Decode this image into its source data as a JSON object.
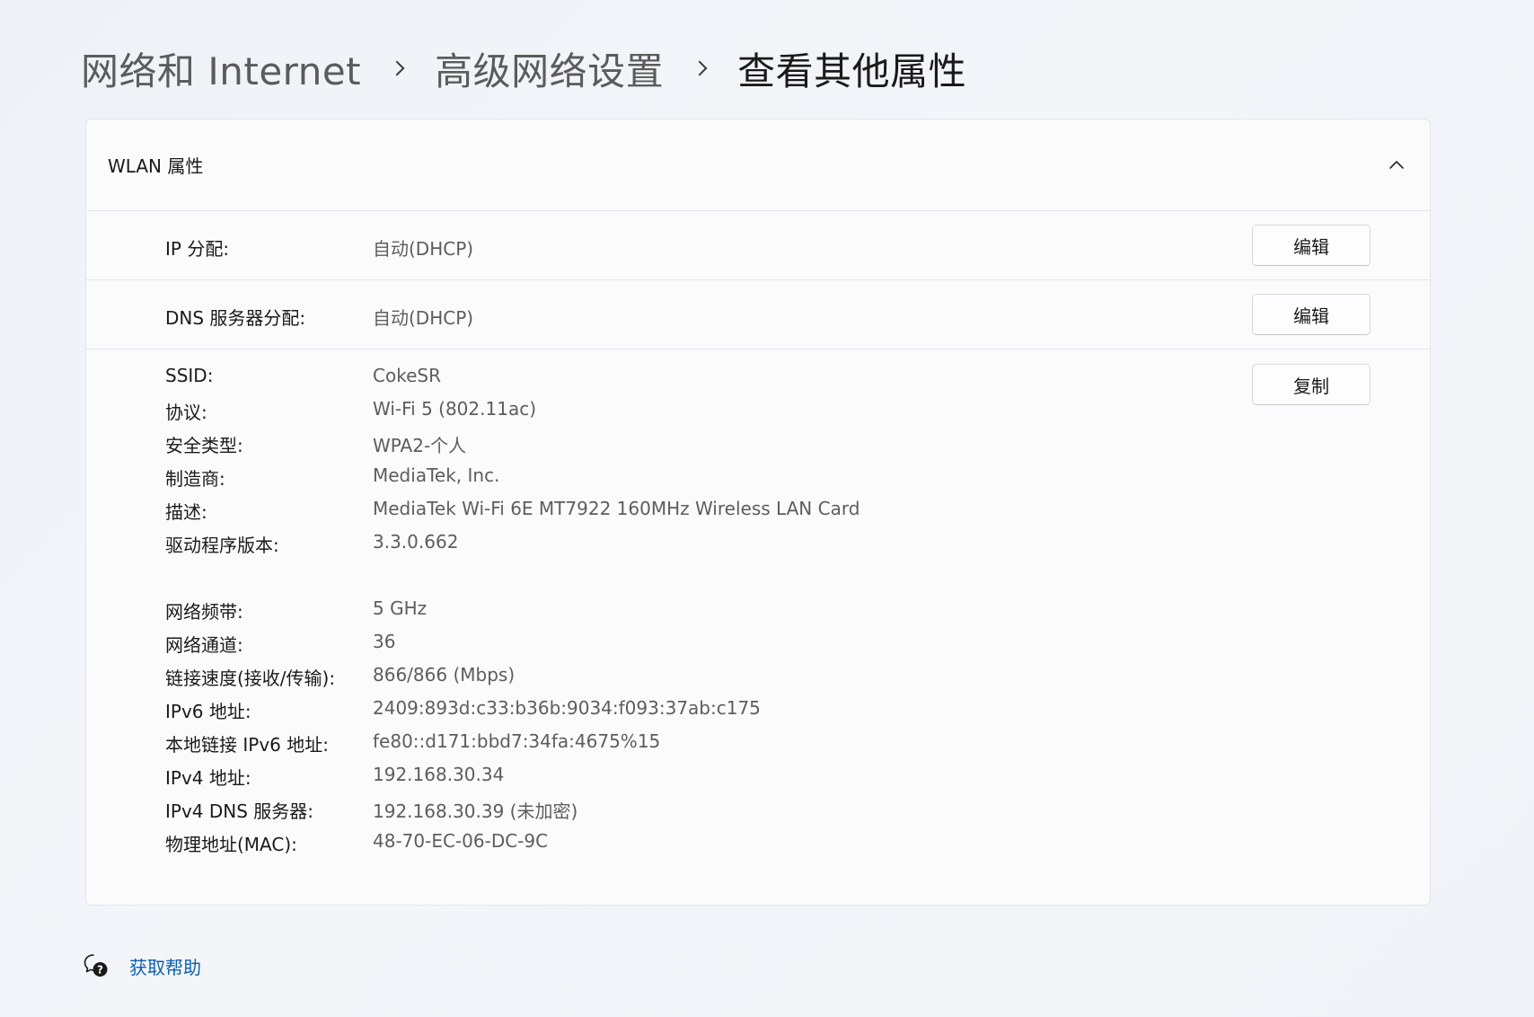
{
  "breadcrumb": {
    "items": [
      "网络和 Internet",
      "高级网络设置"
    ],
    "current": "查看其他属性"
  },
  "card": {
    "title": "WLAN 属性",
    "collapse_icon": "chevron-up-icon",
    "ip_assignment": {
      "label": "IP 分配:",
      "value": "自动(DHCP)",
      "button": "编辑"
    },
    "dns_assignment": {
      "label": "DNS 服务器分配:",
      "value": "自动(DHCP)",
      "button": "编辑"
    },
    "details": {
      "copy_button": "复制",
      "group1": [
        {
          "label": "SSID:",
          "value": "CokeSR"
        },
        {
          "label": "协议:",
          "value": "Wi-Fi 5 (802.11ac)"
        },
        {
          "label": "安全类型:",
          "value": "WPA2-个人"
        },
        {
          "label": "制造商:",
          "value": "MediaTek, Inc."
        },
        {
          "label": "描述:",
          "value": "MediaTek Wi-Fi 6E MT7922 160MHz Wireless LAN Card"
        },
        {
          "label": "驱动程序版本:",
          "value": "3.3.0.662"
        }
      ],
      "group2": [
        {
          "label": "网络频带:",
          "value": "5 GHz"
        },
        {
          "label": "网络通道:",
          "value": "36"
        },
        {
          "label": "链接速度(接收/传输):",
          "value": "866/866 (Mbps)"
        },
        {
          "label": "IPv6 地址:",
          "value": "2409:893d:c33:b36b:9034:f093:37ab:c175"
        },
        {
          "label": "本地链接 IPv6 地址:",
          "value": "fe80::d171:bbd7:34fa:4675%15"
        },
        {
          "label": "IPv4 地址:",
          "value": "192.168.30.34"
        },
        {
          "label": "IPv4 DNS 服务器:",
          "value": "192.168.30.39 (未加密)"
        },
        {
          "label": "物理地址(MAC):",
          "value": "48-70-EC-06-DC-9C"
        }
      ]
    }
  },
  "help": {
    "icon": "help-chat-icon",
    "label": "获取帮助"
  },
  "colors": {
    "link": "#0a5fb4",
    "value_text": "#5d5d5d"
  }
}
